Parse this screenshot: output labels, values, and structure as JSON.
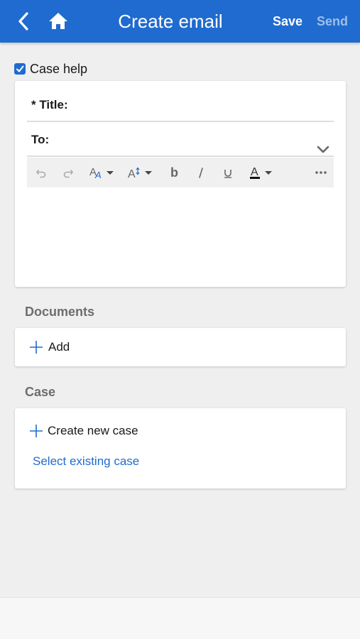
{
  "header": {
    "title": "Create email",
    "save_label": "Save",
    "send_label": "Send",
    "back_icon": "chevron-left-icon",
    "home_icon": "home-icon",
    "bg_color": "#1f6bcf"
  },
  "case_help": {
    "label": "Case help",
    "checked": true
  },
  "email": {
    "title_label": "* Title:",
    "to_label": "To:",
    "toolbar": [
      "undo-icon",
      "redo-icon",
      "font-family-icon",
      "font-size-icon",
      "bold-icon",
      "italic-icon",
      "underline-icon",
      "text-color-icon",
      "more-icon"
    ]
  },
  "documents": {
    "section_label": "Documents",
    "add_label": "Add"
  },
  "case": {
    "section_label": "Case",
    "create_label": "Create new case",
    "select_label": "Select existing case"
  },
  "colors": {
    "accent": "#1f6bcf",
    "disabled_text": "#9dbfe9",
    "section_label": "#6d6d6d"
  }
}
